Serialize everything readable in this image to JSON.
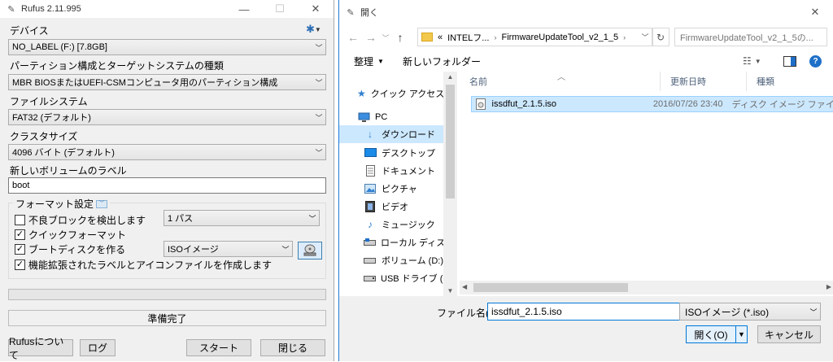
{
  "rufus": {
    "title": "Rufus 2.11.995",
    "device_label": "デバイス",
    "device_value": "NO_LABEL (F:) [7.8GB]",
    "partition_label": "パーティション構成とターゲットシステムの種類",
    "partition_value": "MBR BIOSまたはUEFI-CSMコンピュータ用のパーティション構成",
    "filesystem_label": "ファイルシステム",
    "filesystem_value": "FAT32 (デフォルト)",
    "cluster_label": "クラスタサイズ",
    "cluster_value": "4096 バイト (デフォルト)",
    "volume_label": "新しいボリュームのラベル",
    "volume_value": "boot",
    "format_group": "フォーマット設定",
    "bad_blocks": "不良ブロックを検出します",
    "pass_value": "1 パス",
    "quick_format": "クイックフォーマット",
    "bootdisk": "ブートディスクを作る",
    "boot_type": "ISOイメージ",
    "extended_label": "機能拡張されたラベルとアイコンファイルを作成します",
    "status": "準備完了",
    "about_btn": "Rufusについて",
    "log_btn": "ログ",
    "start_btn": "スタート",
    "close_btn": "閉じる",
    "checked": {
      "bad_blocks": false,
      "quick_format": true,
      "bootdisk": true,
      "extended_label": true
    }
  },
  "dialog": {
    "title": "開く",
    "breadcrumb": [
      "«",
      "INTELフ...",
      "FirmwareUpdateTool_v2_1_5"
    ],
    "search_placeholder": "FirmwareUpdateTool_v2_1_5の...",
    "organize": "整理",
    "new_folder": "新しいフォルダー",
    "nav": [
      {
        "label": "クイック アクセス",
        "icon": "star-icon"
      },
      {
        "label": "PC",
        "icon": "pc-icon"
      },
      {
        "label": "ダウンロード",
        "icon": "download-icon"
      },
      {
        "label": "デスクトップ",
        "icon": "desktop-icon"
      },
      {
        "label": "ドキュメント",
        "icon": "document-icon"
      },
      {
        "label": "ピクチャ",
        "icon": "picture-icon"
      },
      {
        "label": "ビデオ",
        "icon": "video-icon"
      },
      {
        "label": "ミュージック",
        "icon": "music-icon"
      },
      {
        "label": "ローカル ディスク (C",
        "icon": "drive-icon"
      },
      {
        "label": "ボリューム (D:)",
        "icon": "drive-icon"
      },
      {
        "label": "USB ドライブ (F:)",
        "icon": "usb-icon"
      }
    ],
    "columns": {
      "name": "名前",
      "date": "更新日時",
      "type": "種類"
    },
    "file": {
      "name": "issdfut_2.1.5.iso",
      "date": "2016/07/26 23:40",
      "type": "ディスク イメージ ファイル"
    },
    "filename_label": "ファイル名(N):",
    "filename_value": "issdfut_2.1.5.iso",
    "filter_value": "ISOイメージ (*.iso)",
    "open_btn": "開く(O)",
    "cancel_btn": "キャンセル"
  }
}
